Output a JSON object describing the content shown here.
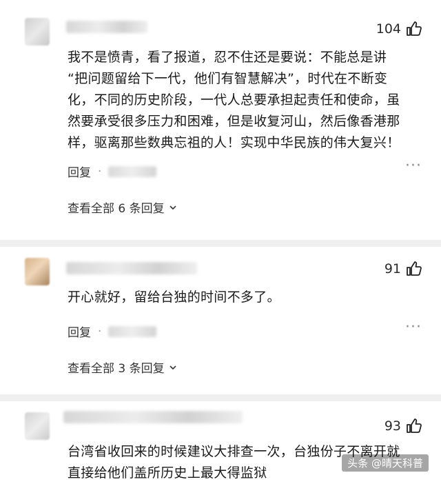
{
  "comments": [
    {
      "likes": "104",
      "text": [
        "我不是愤青，看了报道，忍不住还是要说：不能总是讲",
        "“把问题留给下一代，他们有智慧解决”，时代在不断变",
        "化，不同的历史阶段，一代人总要承担起责任和使命，虽",
        "然要承受很多压力和困难，但是收复河山，然后像香港那",
        "样，驱离那些数典忘祖的人！实现中华民族的伟大复兴！"
      ],
      "reply_label": "回复",
      "view_all": "查看全部 6 条回复"
    },
    {
      "likes": "91",
      "text": [
        "开心就好，留给台独的时间不多了。"
      ],
      "reply_label": "回复",
      "view_all": "查看全部 3 条回复"
    },
    {
      "likes": "93",
      "text": [
        "台湾省收回来的时候建议大排查一次，台独份子不离开就",
        "直接给他们盖所历史上最大得监狱"
      ]
    }
  ],
  "watermark": "头条 @晴天科普",
  "colors": {
    "accent_text": "#1a1a1a",
    "muted": "#8a8a8a",
    "divider": "#f0f0f0"
  }
}
